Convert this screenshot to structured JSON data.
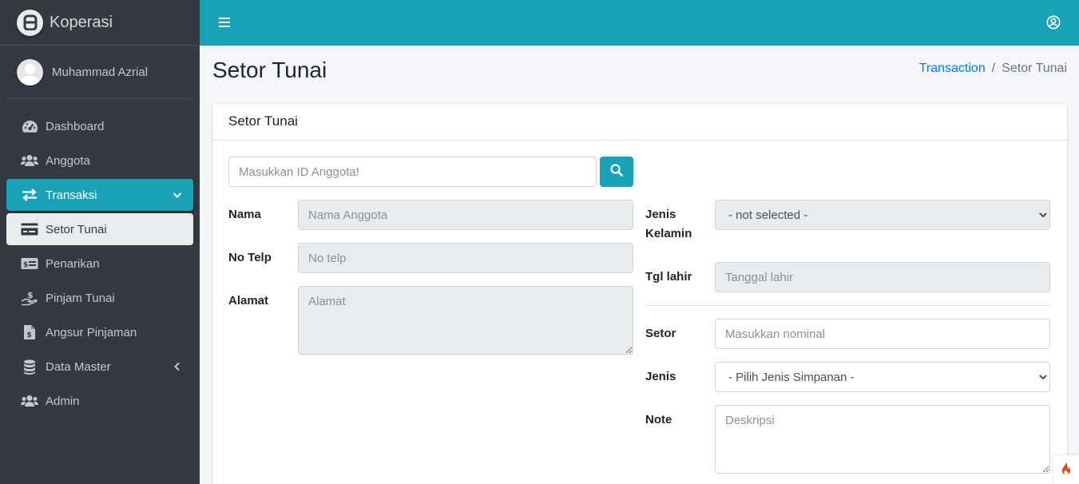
{
  "brand": {
    "name": "Koperasi"
  },
  "user": {
    "name": "Muhammad Azrial"
  },
  "sidebar": {
    "items": [
      {
        "label": "Dashboard",
        "icon": "tachometer-icon"
      },
      {
        "label": "Anggota",
        "icon": "users-icon"
      },
      {
        "label": "Transaksi",
        "icon": "exchange-icon"
      },
      {
        "label": "Setor Tunai",
        "icon": "credit-card-icon"
      },
      {
        "label": "Penarikan",
        "icon": "money-bill-icon"
      },
      {
        "label": "Pinjam Tunai",
        "icon": "hand-dollar-icon"
      },
      {
        "label": "Angsur Pinjaman",
        "icon": "invoice-dollar-icon"
      },
      {
        "label": "Data Master",
        "icon": "database-icon"
      },
      {
        "label": "Admin",
        "icon": "users-icon"
      }
    ]
  },
  "header": {
    "title": "Setor Tunai",
    "breadcrumb": {
      "parent": "Transaction",
      "current": "Setor Tunai"
    }
  },
  "card": {
    "title": "Setor Tunai",
    "search": {
      "placeholder": "Masukkan ID Anggota!"
    },
    "left": {
      "nama": {
        "label": "Nama",
        "placeholder": "Nama Anggota"
      },
      "telp": {
        "label": "No Telp",
        "placeholder": "No telp"
      },
      "alamat": {
        "label": "Alamat",
        "placeholder": "Alamat"
      }
    },
    "right": {
      "gender": {
        "label_1": "Jenis",
        "label_2": "Kelamin",
        "selected": "- not selected -"
      },
      "tgl": {
        "label": "Tgl lahir",
        "placeholder": "Tanggal lahir"
      },
      "setor": {
        "label": "Setor",
        "placeholder": "Masukkan nominal"
      },
      "jenis": {
        "label": "Jenis",
        "selected": "- Pilih Jenis Simpanan -"
      },
      "note": {
        "label": "Note",
        "placeholder": "Deskripsi"
      }
    }
  },
  "colors": {
    "accent": "#17a2b8",
    "sidebar": "#343a40",
    "link": "#007bff",
    "fire": "#dd4814"
  }
}
